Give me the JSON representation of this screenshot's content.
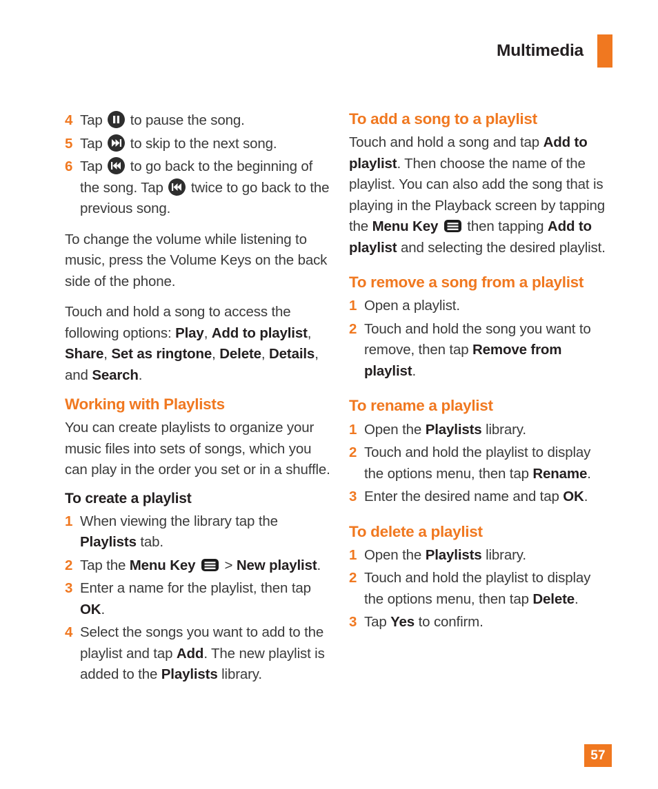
{
  "header": {
    "title": "Multimedia",
    "accent_color": "#f07820",
    "title_color": "#231f20"
  },
  "page_number": "57",
  "icons": {
    "pause": "pause-icon",
    "skip_next": "skip-next-icon",
    "skip_previous": "skip-previous-icon",
    "menu_key": "menu-key-icon"
  },
  "left_column": {
    "steps_playback": {
      "items": [
        {
          "num": "4",
          "parts": [
            {
              "t": "text",
              "v": "Tap "
            },
            {
              "t": "icon",
              "v": "pause"
            },
            {
              "t": "text",
              "v": " to pause the song."
            }
          ]
        },
        {
          "num": "5",
          "parts": [
            {
              "t": "text",
              "v": "Tap "
            },
            {
              "t": "icon",
              "v": "skip_next"
            },
            {
              "t": "text",
              "v": " to skip to the next song."
            }
          ]
        },
        {
          "num": "6",
          "parts": [
            {
              "t": "text",
              "v": "Tap "
            },
            {
              "t": "icon",
              "v": "skip_previous"
            },
            {
              "t": "text",
              "v": " to go back to the beginning of the song. Tap "
            },
            {
              "t": "icon",
              "v": "skip_previous"
            },
            {
              "t": "text",
              "v": " twice to go back to the previous song."
            }
          ]
        }
      ]
    },
    "para_volume": "To change the volume while listening to music, press the Volume Keys on the back side of the phone.",
    "para_touch_hold": {
      "lead": "Touch and hold a song to access the following options: ",
      "options": [
        "Play",
        "Add to playlist",
        "Share",
        "Set as ringtone",
        "Delete",
        "Details",
        "Search"
      ],
      "connector": ", and ",
      "end": "."
    },
    "heading_working_with_playlists": "Working with Playlists",
    "para_create_intro": "You can create playlists to organize your music files into sets of songs, which you can play in the order you set or in a shuffle.",
    "heading_to_create_a_playlist": "To create a playlist",
    "steps_create": {
      "items": [
        {
          "num": "1",
          "parts": [
            {
              "t": "text",
              "v": "When viewing the library tap the "
            },
            {
              "t": "bold",
              "v": "Playlists"
            },
            {
              "t": "text",
              "v": " tab."
            }
          ]
        },
        {
          "num": "2",
          "parts": [
            {
              "t": "text",
              "v": "Tap the "
            },
            {
              "t": "bold",
              "v": "Menu Key"
            },
            {
              "t": "text",
              "v": " "
            },
            {
              "t": "icon",
              "v": "menu_key"
            },
            {
              "t": "text",
              "v": " > "
            },
            {
              "t": "bold",
              "v": "New playlist"
            },
            {
              "t": "text",
              "v": "."
            }
          ]
        },
        {
          "num": "3",
          "parts": [
            {
              "t": "text",
              "v": "Enter a name for the playlist, then tap "
            },
            {
              "t": "bold",
              "v": "OK"
            },
            {
              "t": "text",
              "v": "."
            }
          ]
        },
        {
          "num": "4",
          "parts": [
            {
              "t": "text",
              "v": "Select the songs you want to add to the playlist and tap "
            },
            {
              "t": "bold",
              "v": "Add"
            },
            {
              "t": "text",
              "v": ". The new playlist is added to the "
            },
            {
              "t": "bold",
              "v": "Playlists"
            },
            {
              "t": "text",
              "v": " library."
            }
          ]
        }
      ]
    }
  },
  "right_column": {
    "heading_add_song": "To add a song to a playlist",
    "para_add_song": {
      "parts": [
        {
          "t": "text",
          "v": "Touch and hold a song and tap "
        },
        {
          "t": "bold",
          "v": "Add to playlist"
        },
        {
          "t": "text",
          "v": ". Then choose the name of the playlist. You can also add the song that is playing in the Playback screen by tapping the "
        },
        {
          "t": "bold",
          "v": "Menu Key"
        },
        {
          "t": "text",
          "v": " "
        },
        {
          "t": "icon",
          "v": "menu_key"
        },
        {
          "t": "text",
          "v": " then tapping "
        },
        {
          "t": "bold",
          "v": "Add to playlist"
        },
        {
          "t": "text",
          "v": " and selecting the desired playlist."
        }
      ]
    },
    "heading_remove_song": "To remove a song from a playlist",
    "steps_remove": {
      "items": [
        {
          "num": "1",
          "parts": [
            {
              "t": "text",
              "v": "Open a playlist."
            }
          ]
        },
        {
          "num": "2",
          "parts": [
            {
              "t": "text",
              "v": "Touch and hold the song you want to remove, then tap "
            },
            {
              "t": "bold",
              "v": "Remove from playlist"
            },
            {
              "t": "text",
              "v": "."
            }
          ]
        }
      ]
    },
    "heading_rename": "To rename a playlist",
    "steps_rename": {
      "items": [
        {
          "num": "1",
          "parts": [
            {
              "t": "text",
              "v": "Open the "
            },
            {
              "t": "bold",
              "v": "Playlists"
            },
            {
              "t": "text",
              "v": " library."
            }
          ]
        },
        {
          "num": "2",
          "parts": [
            {
              "t": "text",
              "v": "Touch and hold the playlist to display the options menu, then tap "
            },
            {
              "t": "bold",
              "v": "Rename"
            },
            {
              "t": "text",
              "v": "."
            }
          ]
        },
        {
          "num": "3",
          "parts": [
            {
              "t": "text",
              "v": "Enter the desired name and tap "
            },
            {
              "t": "bold",
              "v": "OK"
            },
            {
              "t": "text",
              "v": "."
            }
          ]
        }
      ]
    },
    "heading_delete": "To delete a playlist",
    "steps_delete": {
      "items": [
        {
          "num": "1",
          "parts": [
            {
              "t": "text",
              "v": "Open the "
            },
            {
              "t": "bold",
              "v": "Playlists"
            },
            {
              "t": "text",
              "v": " library."
            }
          ]
        },
        {
          "num": "2",
          "parts": [
            {
              "t": "text",
              "v": "Touch and hold the playlist to display the options menu, then tap "
            },
            {
              "t": "bold",
              "v": "Delete"
            },
            {
              "t": "text",
              "v": "."
            }
          ]
        },
        {
          "num": "3",
          "parts": [
            {
              "t": "text",
              "v": "Tap "
            },
            {
              "t": "bold",
              "v": "Yes"
            },
            {
              "t": "text",
              "v": " to confirm."
            }
          ]
        }
      ]
    }
  }
}
